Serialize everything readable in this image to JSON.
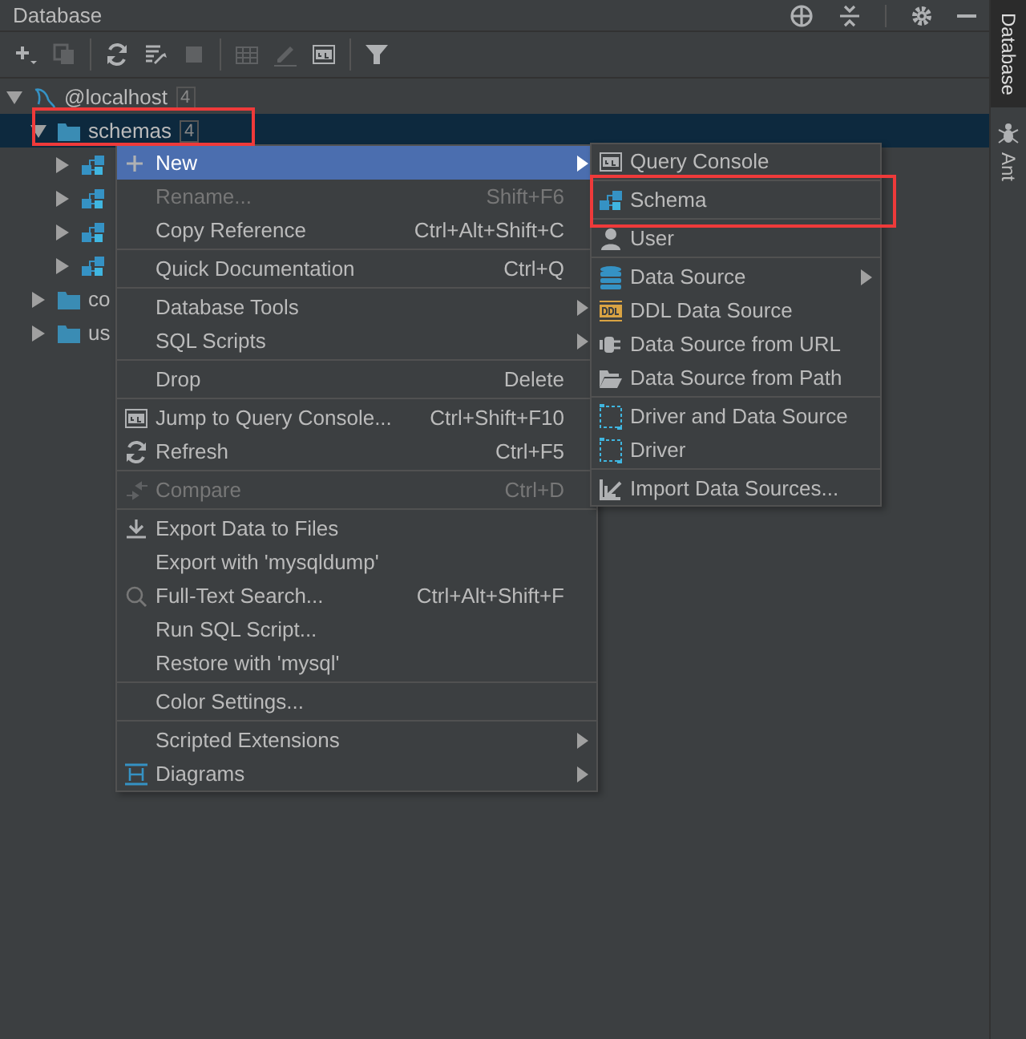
{
  "panel": {
    "title": "Database"
  },
  "toolbar": [
    {
      "kind": "add",
      "disabled": false
    },
    {
      "kind": "copy",
      "disabled": true
    },
    {
      "kind": "separator"
    },
    {
      "kind": "refresh",
      "disabled": false
    },
    {
      "kind": "tool",
      "disabled": false
    },
    {
      "kind": "stop",
      "disabled": true
    },
    {
      "kind": "separator"
    },
    {
      "kind": "table",
      "disabled": true
    },
    {
      "kind": "edit",
      "disabled": true
    },
    {
      "kind": "console",
      "disabled": false
    },
    {
      "kind": "separator"
    },
    {
      "kind": "filter",
      "disabled": false
    }
  ],
  "side_tabs": [
    {
      "label": "Database",
      "selected": true
    },
    {
      "label": "Ant",
      "selected": false,
      "kind": "ant"
    }
  ],
  "tree": [
    {
      "label": "@localhost",
      "count": "4",
      "kind": "mysql",
      "expanded": true,
      "selected": false,
      "children": [
        {
          "label": "schemas",
          "count": "4",
          "kind": "folder",
          "expanded": true,
          "selected": true,
          "children": [
            {
              "kind": "schema",
              "expanded": false,
              "selected": false
            },
            {
              "kind": "schema",
              "expanded": false,
              "selected": false
            },
            {
              "kind": "schema",
              "expanded": false,
              "selected": false
            },
            {
              "kind": "schema",
              "expanded": false,
              "selected": false
            }
          ]
        },
        {
          "label": "co",
          "kind": "folder",
          "expanded": false,
          "selected": false
        },
        {
          "label": "us",
          "kind": "folder",
          "expanded": false,
          "selected": false
        }
      ]
    }
  ],
  "context_menu": [
    [
      {
        "label": "New",
        "kind": "plus",
        "submenu": true,
        "selected": true,
        "disabled": false
      },
      {
        "label": "Rename...",
        "shortcut": "Shift+F6",
        "selected": false,
        "disabled": true
      },
      {
        "label": "Copy Reference",
        "shortcut": "Ctrl+Alt+Shift+C",
        "selected": false,
        "disabled": false
      }
    ],
    [
      {
        "label": "Quick Documentation",
        "shortcut": "Ctrl+Q",
        "selected": false,
        "disabled": false
      }
    ],
    [
      {
        "label": "Database Tools",
        "submenu": true,
        "selected": false,
        "disabled": false
      },
      {
        "label": "SQL Scripts",
        "submenu": true,
        "selected": false,
        "disabled": false
      }
    ],
    [
      {
        "label": "Drop",
        "shortcut": "Delete",
        "selected": false,
        "disabled": false
      }
    ],
    [
      {
        "label": "Jump to Query Console...",
        "kind": "console",
        "shortcut": "Ctrl+Shift+F10",
        "selected": false,
        "disabled": false
      },
      {
        "label": "Refresh",
        "kind": "refresh",
        "shortcut": "Ctrl+F5",
        "selected": false,
        "disabled": false
      }
    ],
    [
      {
        "label": "Compare",
        "kind": "compare",
        "shortcut": "Ctrl+D",
        "selected": false,
        "disabled": true
      }
    ],
    [
      {
        "label": "Export Data to Files",
        "kind": "download",
        "selected": false,
        "disabled": false
      },
      {
        "label": "Export with 'mysqldump'",
        "selected": false,
        "disabled": false
      },
      {
        "label": "Full-Text Search...",
        "kind": "search",
        "shortcut": "Ctrl+Alt+Shift+F",
        "selected": false,
        "disabled": false
      },
      {
        "label": "Run SQL Script...",
        "selected": false,
        "disabled": false
      },
      {
        "label": "Restore with 'mysql'",
        "selected": false,
        "disabled": false
      }
    ],
    [
      {
        "label": "Color Settings...",
        "selected": false,
        "disabled": false
      }
    ],
    [
      {
        "label": "Scripted Extensions",
        "submenu": true,
        "selected": false,
        "disabled": false
      },
      {
        "label": "Diagrams",
        "kind": "diagram",
        "submenu": true,
        "selected": false,
        "disabled": false
      }
    ]
  ],
  "submenu": [
    [
      {
        "label": "Query Console",
        "kind": "console",
        "submenu": false,
        "selected": false
      }
    ],
    [
      {
        "label": "Schema",
        "kind": "schema",
        "submenu": false,
        "selected": false
      }
    ],
    [
      {
        "label": "User",
        "kind": "user",
        "submenu": false,
        "selected": false
      }
    ],
    [
      {
        "label": "Data Source",
        "kind": "datasource",
        "submenu": true,
        "selected": false
      },
      {
        "label": "DDL Data Source",
        "kind": "ddl",
        "submenu": false,
        "selected": false
      },
      {
        "label": "Data Source from URL",
        "kind": "plug",
        "submenu": false,
        "selected": false
      },
      {
        "label": "Data Source from Path",
        "kind": "openfolder",
        "submenu": false,
        "selected": false
      }
    ],
    [
      {
        "label": "Driver and Data Source",
        "kind": "driver",
        "submenu": false,
        "selected": false
      },
      {
        "label": "Driver",
        "kind": "driver",
        "submenu": false,
        "selected": false
      }
    ],
    [
      {
        "label": "Import Data Sources...",
        "kind": "import",
        "submenu": false,
        "selected": false
      }
    ]
  ]
}
